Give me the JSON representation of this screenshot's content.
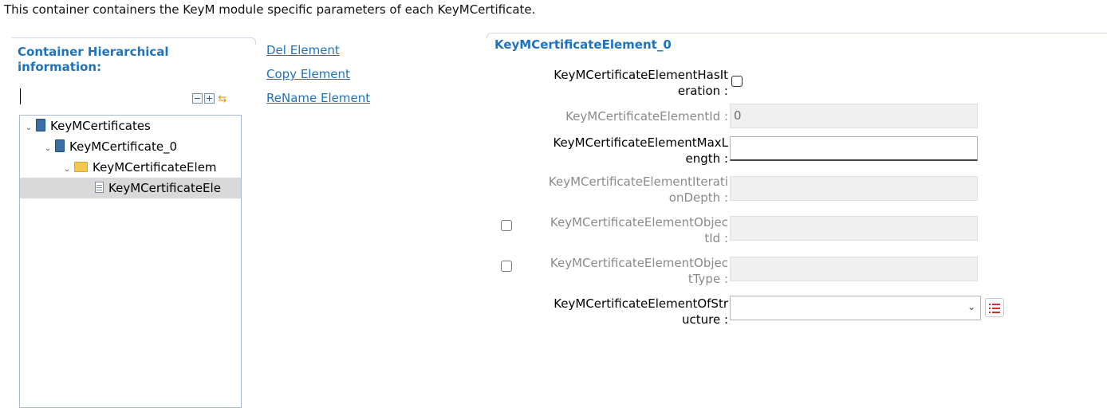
{
  "description": "This container containers the KeyM module specific parameters of each KeyMCertificate.",
  "hierarchy": {
    "title_line1": "Container Hierarchical",
    "title_line2": "information:",
    "tree": [
      {
        "label": "KeyMCertificates",
        "icon": "book-icon",
        "expanded": true
      },
      {
        "label": "KeyMCertificate_0",
        "icon": "book-icon",
        "expanded": true
      },
      {
        "label": "KeyMCertificateElem",
        "icon": "folder-icon",
        "expanded": true
      },
      {
        "label": "KeyMCertificateEle",
        "icon": "page-icon",
        "selected": true
      }
    ]
  },
  "actions": {
    "del": "Del Element",
    "copy": "Copy Element",
    "rename": "ReName Element"
  },
  "element": {
    "title": "KeyMCertificateElement_0",
    "fields": {
      "has_iteration": {
        "label1": "KeyMCertificateElementHasIt",
        "label2": "eration :",
        "checked": false
      },
      "element_id": {
        "label": "KeyMCertificateElementId :",
        "value": "0"
      },
      "max_length": {
        "label1": "KeyMCertificateElementMaxL",
        "label2": "ength :",
        "value": ""
      },
      "iteration_depth": {
        "label1": "KeyMCertificateElementIterati",
        "label2": "onDepth :",
        "value": ""
      },
      "object_id": {
        "label1": "KeyMCertificateElementObjec",
        "label2": "tId :",
        "value": ""
      },
      "object_type": {
        "label1": "KeyMCertificateElementObjec",
        "label2": "tType :",
        "value": ""
      },
      "of_structure": {
        "label1": "KeyMCertificateElementOfStr",
        "label2": "ucture :",
        "value": ""
      }
    }
  },
  "colors": {
    "accent": "#1e73be",
    "selection": "#d9d9d9",
    "disabled_field": "#f0f0f0"
  }
}
